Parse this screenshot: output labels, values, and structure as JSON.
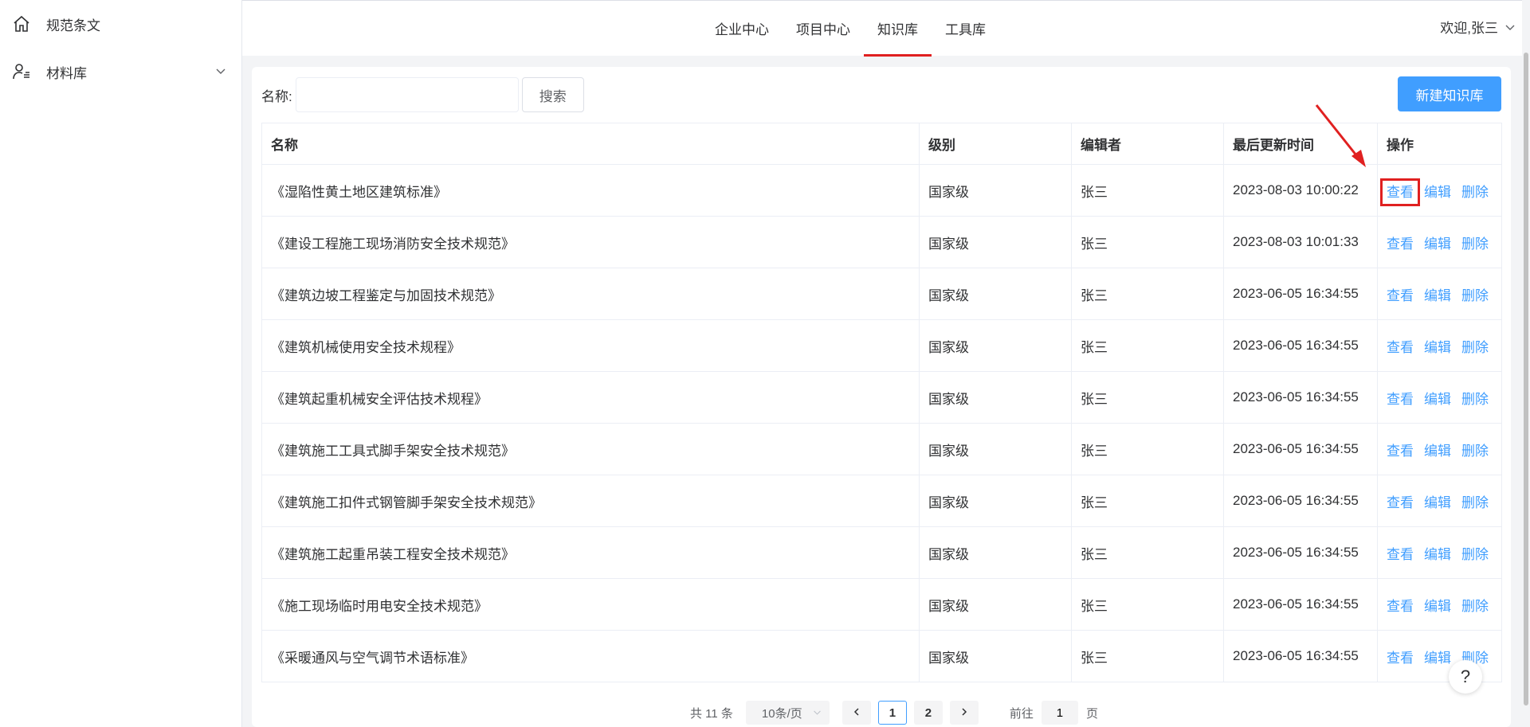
{
  "sidebar": {
    "items": [
      {
        "label": "规范条文",
        "icon": "home-icon"
      },
      {
        "label": "材料库",
        "icon": "user-list-icon"
      }
    ]
  },
  "header": {
    "nav": [
      {
        "label": "企业中心"
      },
      {
        "label": "项目中心"
      },
      {
        "label": "知识库",
        "active": true
      },
      {
        "label": "工具库"
      }
    ],
    "user_label": "欢迎,张三"
  },
  "search": {
    "label": "名称:",
    "value": "",
    "placeholder": "",
    "button_label": "搜索"
  },
  "new_button_label": "新建知识库",
  "table": {
    "columns": [
      "名称",
      "级别",
      "编辑者",
      "最后更新时间",
      "操作"
    ],
    "actions": [
      "查看",
      "编辑",
      "删除"
    ],
    "rows": [
      {
        "name": "《湿陷性黄土地区建筑标准》",
        "level": "国家级",
        "editor": "张三",
        "updated": "2023-08-03 10:00:22"
      },
      {
        "name": "《建设工程施工现场消防安全技术规范》",
        "level": "国家级",
        "editor": "张三",
        "updated": "2023-08-03 10:01:33"
      },
      {
        "name": "《建筑边坡工程鉴定与加固技术规范》",
        "level": "国家级",
        "editor": "张三",
        "updated": "2023-06-05 16:34:55"
      },
      {
        "name": "《建筑机械使用安全技术规程》",
        "level": "国家级",
        "editor": "张三",
        "updated": "2023-06-05 16:34:55"
      },
      {
        "name": "《建筑起重机械安全评估技术规程》",
        "level": "国家级",
        "editor": "张三",
        "updated": "2023-06-05 16:34:55"
      },
      {
        "name": "《建筑施工工具式脚手架安全技术规范》",
        "level": "国家级",
        "editor": "张三",
        "updated": "2023-06-05 16:34:55"
      },
      {
        "name": "《建筑施工扣件式钢管脚手架安全技术规范》",
        "level": "国家级",
        "editor": "张三",
        "updated": "2023-06-05 16:34:55"
      },
      {
        "name": "《建筑施工起重吊装工程安全技术规范》",
        "level": "国家级",
        "editor": "张三",
        "updated": "2023-06-05 16:34:55"
      },
      {
        "name": "《施工现场临时用电安全技术规范》",
        "level": "国家级",
        "editor": "张三",
        "updated": "2023-06-05 16:34:55"
      },
      {
        "name": "《采暖通风与空气调节术语标准》",
        "level": "国家级",
        "editor": "张三",
        "updated": "2023-06-05 16:34:55"
      }
    ]
  },
  "pagination": {
    "total_text": "共 11 条",
    "page_size": "10条/页",
    "pages": [
      "1",
      "2"
    ],
    "current": "1",
    "goto_prefix": "前往",
    "goto_value": "1",
    "goto_suffix": "页"
  },
  "help_label": "?",
  "colors": {
    "primary": "#409eff",
    "active_nav": "#e02020",
    "annotation": "#e02020"
  }
}
